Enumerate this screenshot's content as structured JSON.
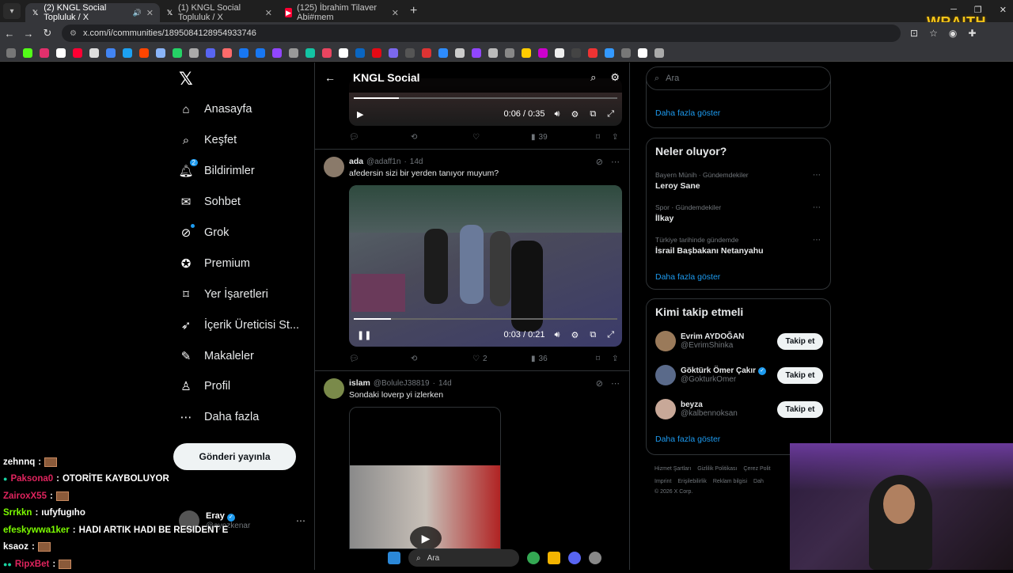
{
  "browser": {
    "tabs": [
      {
        "title": "(2) KNGL Social Topluluk / X",
        "active": true,
        "favicon": "x-icon"
      },
      {
        "title": "(1) KNGL Social Topluluk / X",
        "active": false,
        "favicon": "x-icon"
      },
      {
        "title": "(125) İbrahim Tilaver Abi#mem",
        "active": false,
        "favicon": "youtube-icon"
      }
    ],
    "url": "x.com/i/communities/1895084128954933746",
    "overlay_brand": "WRAITH"
  },
  "nav": {
    "items": [
      {
        "label": "Anasayfa",
        "icon": "home-icon"
      },
      {
        "label": "Keşfet",
        "icon": "search-icon"
      },
      {
        "label": "Bildirimler",
        "icon": "bell-icon",
        "badge": "2"
      },
      {
        "label": "Sohbet",
        "icon": "mail-icon"
      },
      {
        "label": "Grok",
        "icon": "grok-icon"
      },
      {
        "label": "Premium",
        "icon": "premium-icon"
      },
      {
        "label": "Yer İşaretleri",
        "icon": "bookmark-icon"
      },
      {
        "label": "İçerik Üreticisi St...",
        "icon": "rocket-icon"
      },
      {
        "label": "Makaleler",
        "icon": "article-icon"
      },
      {
        "label": "Profil",
        "icon": "person-icon"
      },
      {
        "label": "Daha fazla",
        "icon": "more-circle-icon"
      }
    ],
    "post_button": "Gönderi yayınla",
    "user": {
      "name": "Eray",
      "handle": "@ayozkenar"
    }
  },
  "community": {
    "title": "KNGL Social",
    "first_video": {
      "time": "0:06 / 0:35",
      "progress": 0.17,
      "views": "39"
    },
    "tweets": [
      {
        "name": "ada",
        "handle": "@adaff1n",
        "age": "14d",
        "text": "afedersin sizi bir yerden tanıyor muyum?",
        "video_time": "0:03 / 0:21",
        "progress": 0.14,
        "likes": "2",
        "views": "36"
      },
      {
        "name": "islam",
        "handle": "@BoluleJ38819",
        "age": "14d",
        "text": "Sondaki loverp yi izlerken"
      }
    ]
  },
  "sidebar": {
    "search_placeholder": "Ara",
    "top_show_more": "Daha fazla göster",
    "trends_title": "Neler oluyor?",
    "trends": [
      {
        "meta": "Bayern Münih · Gündemdekiler",
        "name": "Leroy Sane"
      },
      {
        "meta": "Spor · Gündemdekiler",
        "name": "İlkay"
      },
      {
        "meta": "Türkiye tarihinde gündemde",
        "name": "İsrail Başbakanı Netanyahu"
      }
    ],
    "trends_show_more": "Daha fazla göster",
    "follow_title": "Kimi takip etmeli",
    "follow": [
      {
        "name": "Evrim AYDOĞAN",
        "handle": "@EvrimShinka",
        "verified": false,
        "button": "Takip et"
      },
      {
        "name": "Göktürk Ömer Çakır",
        "handle": "@GokturkOmer",
        "verified": true,
        "button": "Takip et"
      },
      {
        "name": "beyza",
        "handle": "@kalbennoksan",
        "verified": false,
        "button": "Takip et"
      }
    ],
    "follow_show_more": "Daha fazla göster",
    "footer": [
      "Hizmet Şartları",
      "Gizlilik Politikası",
      "Çerez Polit",
      "Imprint",
      "Erişilebilirlik",
      "Reklam bilgisi",
      "Dah",
      "© 2026 X Corp."
    ]
  },
  "stream_chat": [
    {
      "user": "zehnnq",
      "color": "#ffffff",
      "msg": "",
      "emote": true
    },
    {
      "user": "Paksona0",
      "color": "#e0245e",
      "msg": "OTORİTE KAYBOLUYOR",
      "emote": false
    },
    {
      "user": "ZairoxX55",
      "color": "#e0245e",
      "msg": "",
      "emote": true
    },
    {
      "user": "Srrkkn",
      "color": "#7cfc00",
      "msg": "ıufyfugıho",
      "emote": false
    },
    {
      "user": "efeskywwa1ker",
      "color": "#7cfc00",
      "msg": "HADI ARTIK HADI BE RESIDENT E",
      "emote": false
    },
    {
      "user": "ksaoz",
      "color": "#ffffff",
      "msg": "",
      "emote": true
    },
    {
      "user": "RipxBet",
      "color": "#e0245e",
      "msg": "",
      "emote": true
    }
  ],
  "taskbar": {
    "search_placeholder": "Ara"
  }
}
